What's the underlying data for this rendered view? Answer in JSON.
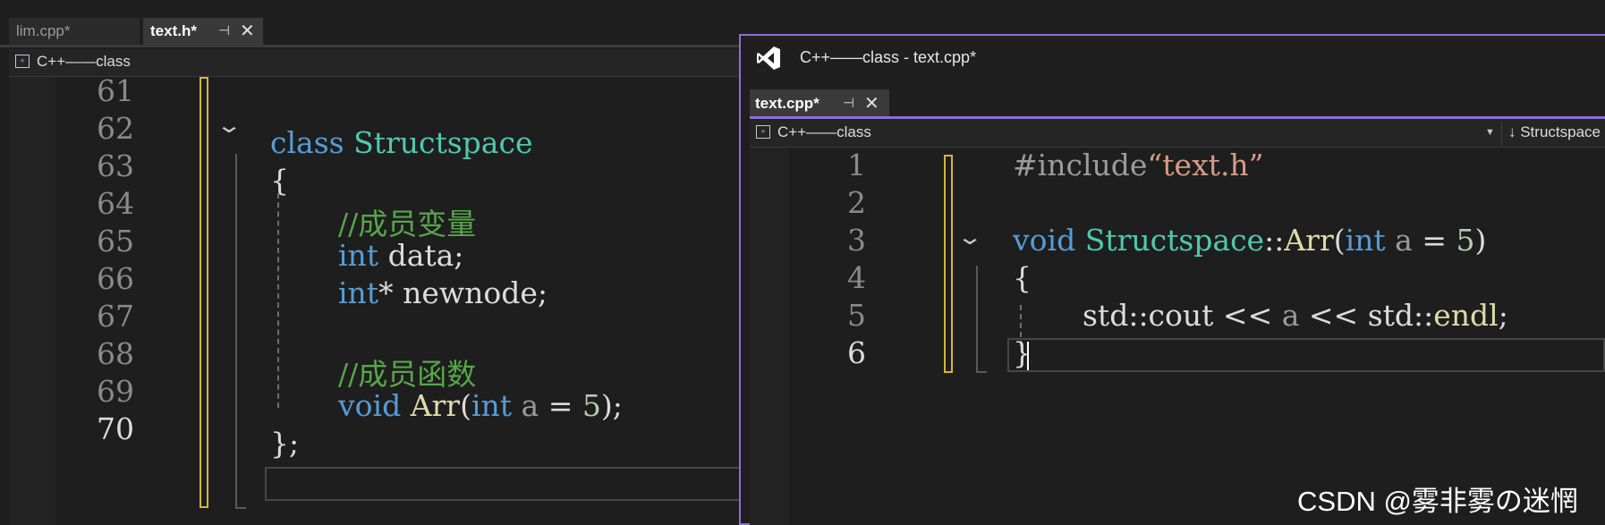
{
  "left_editor": {
    "tabs": [
      {
        "label": "lim.cpp*"
      },
      {
        "label": "text.h*",
        "pin": "⊣",
        "close": "✕"
      }
    ],
    "nav_scope": "C++——class",
    "code_lines": [
      {
        "num": "61"
      },
      {
        "num": "62"
      },
      {
        "num": "63"
      },
      {
        "num": "64"
      },
      {
        "num": "65"
      },
      {
        "num": "66"
      },
      {
        "num": "67"
      },
      {
        "num": "68"
      },
      {
        "num": "69"
      },
      {
        "num": "70"
      }
    ],
    "code": {
      "l62_kw": "class",
      "l62_ty": "Structspace",
      "l63": "{",
      "l64": "//成员变量",
      "l65_kw": "int",
      "l65_rest": " data;",
      "l66_kw": "int",
      "l66_rest": "* newnode;",
      "l68": "//成员函数",
      "l69_kw": "void",
      "l69_fn": "Arr",
      "l69_p1": "(",
      "l69_kw2": "int",
      "l69_pa": " a ",
      "l69_eq": "= ",
      "l69_nm": "5",
      "l69_end": ");",
      "l70": "};"
    }
  },
  "right_window": {
    "title": "C++——class - text.cpp*",
    "tab": {
      "label": "text.cpp*",
      "pin": "⊣",
      "close": "✕"
    },
    "nav_scope": "C++——class",
    "nav_member": "↓ Structspace",
    "code_lines": [
      {
        "num": "1"
      },
      {
        "num": "2"
      },
      {
        "num": "3"
      },
      {
        "num": "4"
      },
      {
        "num": "5"
      },
      {
        "num": "6"
      }
    ],
    "code": {
      "l1_pp": "#include",
      "l1_st": "“text.h”",
      "l3_kw": "void",
      "l3_ty": "Structspace",
      "l3_sep": "::",
      "l3_fn": "Arr",
      "l3_p1": "(",
      "l3_kw2": "int",
      "l3_pa": " a ",
      "l3_eq": "= ",
      "l3_nm": "5",
      "l3_end": ")",
      "l4": "{",
      "l5_a": "std::cout ",
      "l5_op1": "<<",
      "l5_pa": " a ",
      "l5_op2": "<<",
      "l5_b": " std::",
      "l5_fn": "endl",
      "l5_end": ";",
      "l6": "}"
    }
  },
  "watermark": "CSDN @雾非雾の迷惘",
  "colors": {
    "keyword": "#569cd6",
    "type": "#4ec9b0",
    "function": "#dcdcaa",
    "comment": "#57a64a",
    "string": "#d69d85",
    "accent": "#8d6fd6",
    "change_marker": "#d7b636"
  }
}
